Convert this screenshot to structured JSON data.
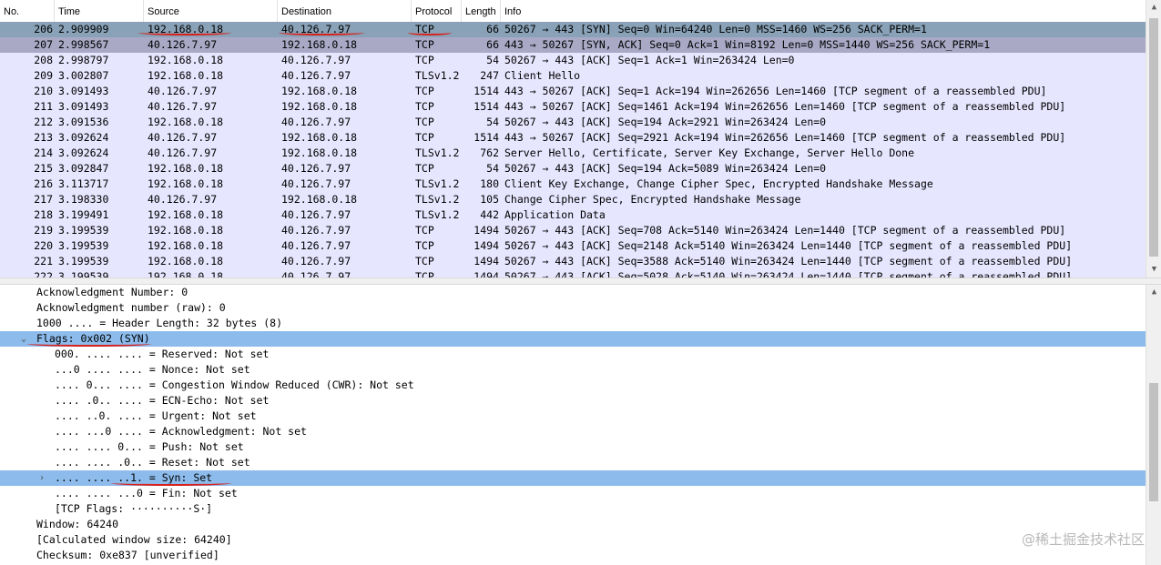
{
  "columns": {
    "no": "No.",
    "time": "Time",
    "source": "Source",
    "destination": "Destination",
    "protocol": "Protocol",
    "length": "Length",
    "info": "Info"
  },
  "packets": [
    {
      "no": "206",
      "time": "2.909909",
      "src": "192.168.0.18",
      "dst": "40.126.7.97",
      "proto": "TCP",
      "len": "66",
      "info": "50267 → 443 [SYN] Seq=0 Win=64240 Len=0 MSS=1460 WS=256 SACK_PERM=1"
    },
    {
      "no": "207",
      "time": "2.998567",
      "src": "40.126.7.97",
      "dst": "192.168.0.18",
      "proto": "TCP",
      "len": "66",
      "info": "443 → 50267 [SYN, ACK] Seq=0 Ack=1 Win=8192 Len=0 MSS=1440 WS=256 SACK_PERM=1"
    },
    {
      "no": "208",
      "time": "2.998797",
      "src": "192.168.0.18",
      "dst": "40.126.7.97",
      "proto": "TCP",
      "len": "54",
      "info": "50267 → 443 [ACK] Seq=1 Ack=1 Win=263424 Len=0"
    },
    {
      "no": "209",
      "time": "3.002807",
      "src": "192.168.0.18",
      "dst": "40.126.7.97",
      "proto": "TLSv1.2",
      "len": "247",
      "info": "Client Hello"
    },
    {
      "no": "210",
      "time": "3.091493",
      "src": "40.126.7.97",
      "dst": "192.168.0.18",
      "proto": "TCP",
      "len": "1514",
      "info": "443 → 50267 [ACK] Seq=1 Ack=194 Win=262656 Len=1460 [TCP segment of a reassembled PDU]"
    },
    {
      "no": "211",
      "time": "3.091493",
      "src": "40.126.7.97",
      "dst": "192.168.0.18",
      "proto": "TCP",
      "len": "1514",
      "info": "443 → 50267 [ACK] Seq=1461 Ack=194 Win=262656 Len=1460 [TCP segment of a reassembled PDU]"
    },
    {
      "no": "212",
      "time": "3.091536",
      "src": "192.168.0.18",
      "dst": "40.126.7.97",
      "proto": "TCP",
      "len": "54",
      "info": "50267 → 443 [ACK] Seq=194 Ack=2921 Win=263424 Len=0"
    },
    {
      "no": "213",
      "time": "3.092624",
      "src": "40.126.7.97",
      "dst": "192.168.0.18",
      "proto": "TCP",
      "len": "1514",
      "info": "443 → 50267 [ACK] Seq=2921 Ack=194 Win=262656 Len=1460 [TCP segment of a reassembled PDU]"
    },
    {
      "no": "214",
      "time": "3.092624",
      "src": "40.126.7.97",
      "dst": "192.168.0.18",
      "proto": "TLSv1.2",
      "len": "762",
      "info": "Server Hello, Certificate, Server Key Exchange, Server Hello Done"
    },
    {
      "no": "215",
      "time": "3.092847",
      "src": "192.168.0.18",
      "dst": "40.126.7.97",
      "proto": "TCP",
      "len": "54",
      "info": "50267 → 443 [ACK] Seq=194 Ack=5089 Win=263424 Len=0"
    },
    {
      "no": "216",
      "time": "3.113717",
      "src": "192.168.0.18",
      "dst": "40.126.7.97",
      "proto": "TLSv1.2",
      "len": "180",
      "info": "Client Key Exchange, Change Cipher Spec, Encrypted Handshake Message"
    },
    {
      "no": "217",
      "time": "3.198330",
      "src": "40.126.7.97",
      "dst": "192.168.0.18",
      "proto": "TLSv1.2",
      "len": "105",
      "info": "Change Cipher Spec, Encrypted Handshake Message"
    },
    {
      "no": "218",
      "time": "3.199491",
      "src": "192.168.0.18",
      "dst": "40.126.7.97",
      "proto": "TLSv1.2",
      "len": "442",
      "info": "Application Data"
    },
    {
      "no": "219",
      "time": "3.199539",
      "src": "192.168.0.18",
      "dst": "40.126.7.97",
      "proto": "TCP",
      "len": "1494",
      "info": "50267 → 443 [ACK] Seq=708 Ack=5140 Win=263424 Len=1440 [TCP segment of a reassembled PDU]"
    },
    {
      "no": "220",
      "time": "3.199539",
      "src": "192.168.0.18",
      "dst": "40.126.7.97",
      "proto": "TCP",
      "len": "1494",
      "info": "50267 → 443 [ACK] Seq=2148 Ack=5140 Win=263424 Len=1440 [TCP segment of a reassembled PDU]"
    },
    {
      "no": "221",
      "time": "3.199539",
      "src": "192.168.0.18",
      "dst": "40.126.7.97",
      "proto": "TCP",
      "len": "1494",
      "info": "50267 → 443 [ACK] Seq=3588 Ack=5140 Win=263424 Len=1440 [TCP segment of a reassembled PDU]"
    },
    {
      "no": "222",
      "time": "3.199539",
      "src": "192.168.0.18",
      "dst": "40.126.7.97",
      "proto": "TCP",
      "len": "1494",
      "info": "50267 → 443 [ACK] Seq=5028 Ack=5140 Win=263424 Len=1440 [TCP segment of a reassembled PDU]"
    }
  ],
  "details": [
    {
      "text": "Acknowledgment Number: 0"
    },
    {
      "text": "Acknowledgment number (raw): 0"
    },
    {
      "text": "1000 .... = Header Length: 32 bytes (8)"
    },
    {
      "text": "Flags: 0x002 (SYN)",
      "toggle": "expanded"
    },
    {
      "text": "000. .... .... = Reserved: Not set"
    },
    {
      "text": "...0 .... .... = Nonce: Not set"
    },
    {
      "text": ".... 0... .... = Congestion Window Reduced (CWR): Not set"
    },
    {
      "text": ".... .0.. .... = ECN-Echo: Not set"
    },
    {
      "text": ".... ..0. .... = Urgent: Not set"
    },
    {
      "text": ".... ...0 .... = Acknowledgment: Not set"
    },
    {
      "text": ".... .... 0... = Push: Not set"
    },
    {
      "text": ".... .... .0.. = Reset: Not set"
    },
    {
      "text": ".... .... ..1. = Syn: Set",
      "toggle": "collapsed"
    },
    {
      "text": ".... .... ...0 = Fin: Not set"
    },
    {
      "text": "[TCP Flags: ··········S·]"
    },
    {
      "text": "Window: 64240"
    },
    {
      "text": "[Calculated window size: 64240]"
    },
    {
      "text": "Checksum: 0xe837 [unverified]"
    }
  ],
  "icons": {
    "scroll_up": "▲",
    "scroll_down": "▼",
    "expanded": "⌄",
    "collapsed": "›"
  },
  "colors": {
    "selected_row": "#89a2b7",
    "marked_row": "#a9a9c6",
    "tcp_row": "#e7e6ff",
    "detail_highlight": "#8dbbeb",
    "annotation": "#d8201b"
  },
  "watermark": "@稀土掘金技术社区"
}
